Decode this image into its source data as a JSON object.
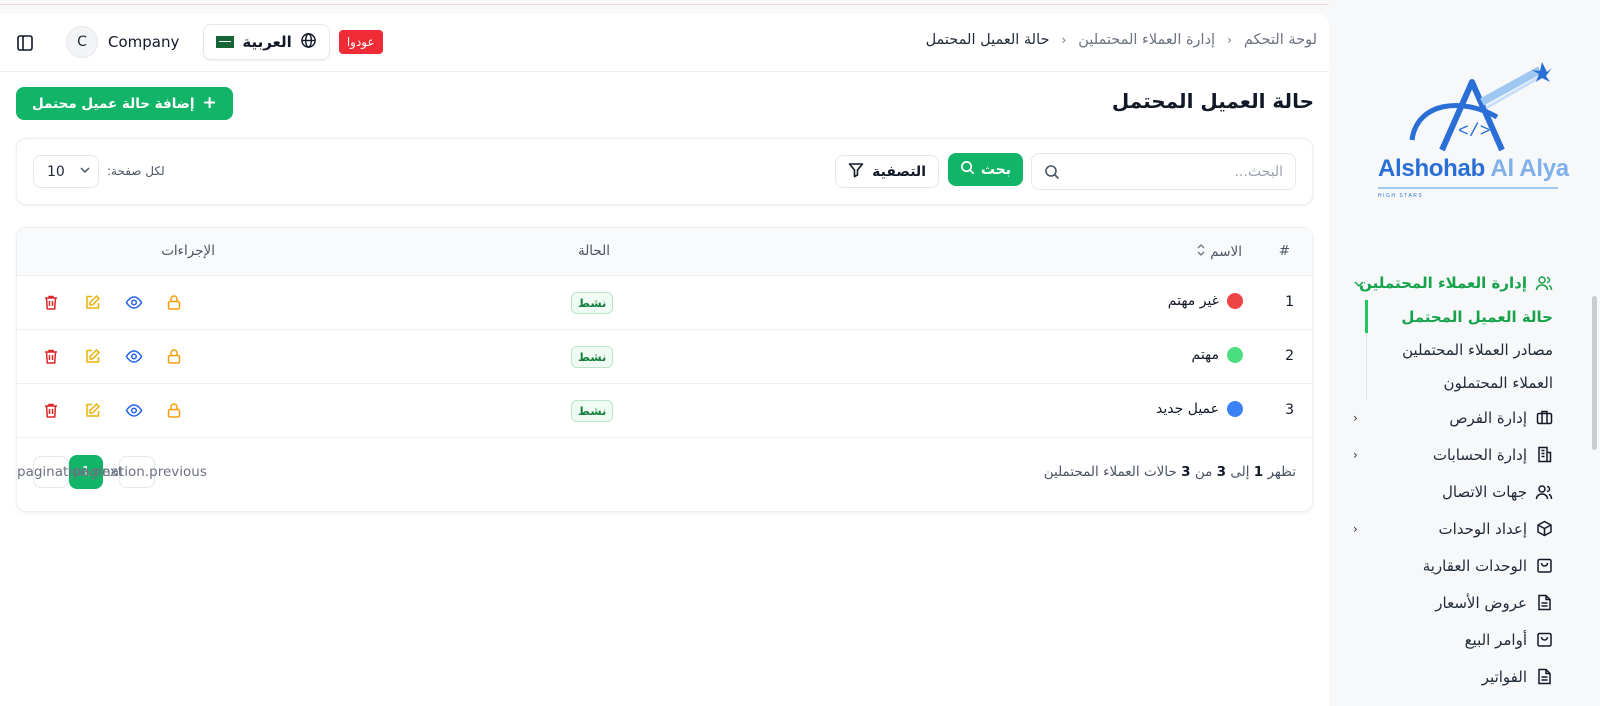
{
  "header": {
    "breadcrumb": [
      "لوحة التحكم",
      "إدارة العملاء المحتملين",
      "حالة العميل المحتمل"
    ],
    "avatar_initial": "C",
    "company": "Company",
    "language": "العربية",
    "badge": "عودوا"
  },
  "sidebar": {
    "logo_word1": "Alshohab",
    "logo_word2": "Al Alya",
    "logo_tagline": "HIGH STARS",
    "group": {
      "label": "إدارة العملاء المحتملين",
      "icon": "users-icon"
    },
    "sub_items": [
      {
        "label": "حالة العميل المحتمل",
        "active": true
      },
      {
        "label": "مصادر العملاء المحتملين",
        "active": false
      },
      {
        "label": "العملاء المحتملون",
        "active": false
      }
    ],
    "items": [
      {
        "label": "إدارة الفرص",
        "icon": "briefcase-icon",
        "has_children": true
      },
      {
        "label": "إدارة الحسابات",
        "icon": "building-icon",
        "has_children": true
      },
      {
        "label": "جهات الاتصال",
        "icon": "contacts-icon",
        "has_children": false
      },
      {
        "label": "إعداد الوحدات",
        "icon": "cube-icon",
        "has_children": true
      },
      {
        "label": "الوحدات العقارية",
        "icon": "bag-icon",
        "has_children": false
      },
      {
        "label": "عروض الأسعار",
        "icon": "document-icon",
        "has_children": false
      },
      {
        "label": "أوامر البيع",
        "icon": "bag-icon",
        "has_children": false
      },
      {
        "label": "الفواتير",
        "icon": "document-icon",
        "has_children": false
      }
    ]
  },
  "page": {
    "title": "حالة العميل المحتمل",
    "add_button": "إضافة حالة عميل محتمل"
  },
  "toolbar": {
    "search_placeholder": "البحث...",
    "search_button": "بحث",
    "filter_button": "التصفية",
    "per_page_label": "لكل صفحة:",
    "per_page_value": "10"
  },
  "table": {
    "headers": {
      "num": "#",
      "name": "الاسم",
      "status": "الحالة",
      "actions": "الإجراءات"
    },
    "rows": [
      {
        "num": "1",
        "name": "غير مهتم",
        "color": "#ef4444",
        "status": "نشط"
      },
      {
        "num": "2",
        "name": "مهتم",
        "color": "#4ade80",
        "status": "نشط"
      },
      {
        "num": "3",
        "name": "عميل جديد",
        "color": "#3b82f6",
        "status": "نشط"
      }
    ]
  },
  "footer": {
    "prefix": "تظهر",
    "from": "1",
    "to_word": "إلى",
    "to": "3",
    "of_word": "من",
    "total": "3",
    "suffix": "حالات العملاء المحتملين"
  },
  "pagination": {
    "previous": "pagination.previous",
    "next": "pagination.next",
    "current_page": "1"
  },
  "colors": {
    "primary": "#12b468",
    "active_nav": "#16a34a",
    "badge_red": "#ef2b36",
    "delete": "#dc2626",
    "edit": "#eab308",
    "view": "#2563eb",
    "lock": "#f59e0b"
  }
}
